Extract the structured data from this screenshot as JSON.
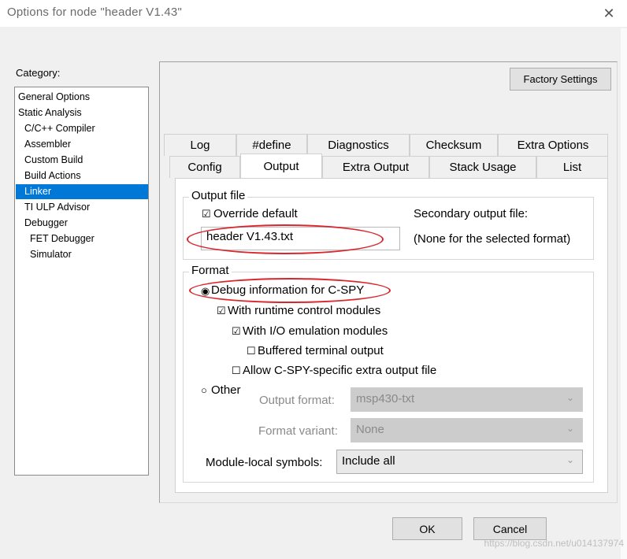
{
  "window": {
    "title": "Options for node \"header V1.43\"",
    "close_glyph": "✕"
  },
  "category": {
    "label": "Category:",
    "items": [
      "General Options",
      "Static Analysis",
      "C/C++ Compiler",
      "Assembler",
      "Custom Build",
      "Build Actions",
      "Linker",
      "TI ULP Advisor",
      "Debugger",
      "FET Debugger",
      "Simulator"
    ],
    "selected": "Linker"
  },
  "factory_settings": "Factory Settings",
  "tabs": {
    "row1": [
      "Log",
      "#define",
      "Diagnostics",
      "Checksum",
      "Extra Options"
    ],
    "row2": [
      "Config",
      "Output",
      "Extra Output",
      "Stack Usage",
      "List"
    ],
    "active": "Output"
  },
  "output_file": {
    "group_title": "Output file",
    "override_check": "☑",
    "override_label": "Override default",
    "filename": "header V1.43.txt",
    "secondary_label": "Secondary output file:",
    "secondary_value": "(None for the selected format)"
  },
  "format": {
    "group_title": "Format",
    "debug_radio": "◉",
    "debug_label": "Debug information for C-SPY",
    "runtime_check": "☑",
    "runtime_label": "With runtime control modules",
    "io_check": "☑",
    "io_label": "With I/O emulation modules",
    "buffered_check": "☐",
    "buffered_label": "Buffered terminal output",
    "allow_check": "☐",
    "allow_label": "Allow C-SPY-specific extra output file",
    "other_radio": "○",
    "other_label": "Other",
    "output_format_label": "Output format:",
    "output_format_value": "msp430-txt",
    "format_variant_label": "Format variant:",
    "format_variant_value": "None",
    "module_local_label": "Module-local symbols:",
    "module_local_value": "Include all",
    "chevron": "⌄"
  },
  "buttons": {
    "ok": "OK",
    "cancel": "Cancel"
  },
  "watermark": "https://blog.csdn.net/u014137974",
  "colors": {
    "selection": "#0078d7",
    "highlight_ellipse": "#d9252c"
  }
}
